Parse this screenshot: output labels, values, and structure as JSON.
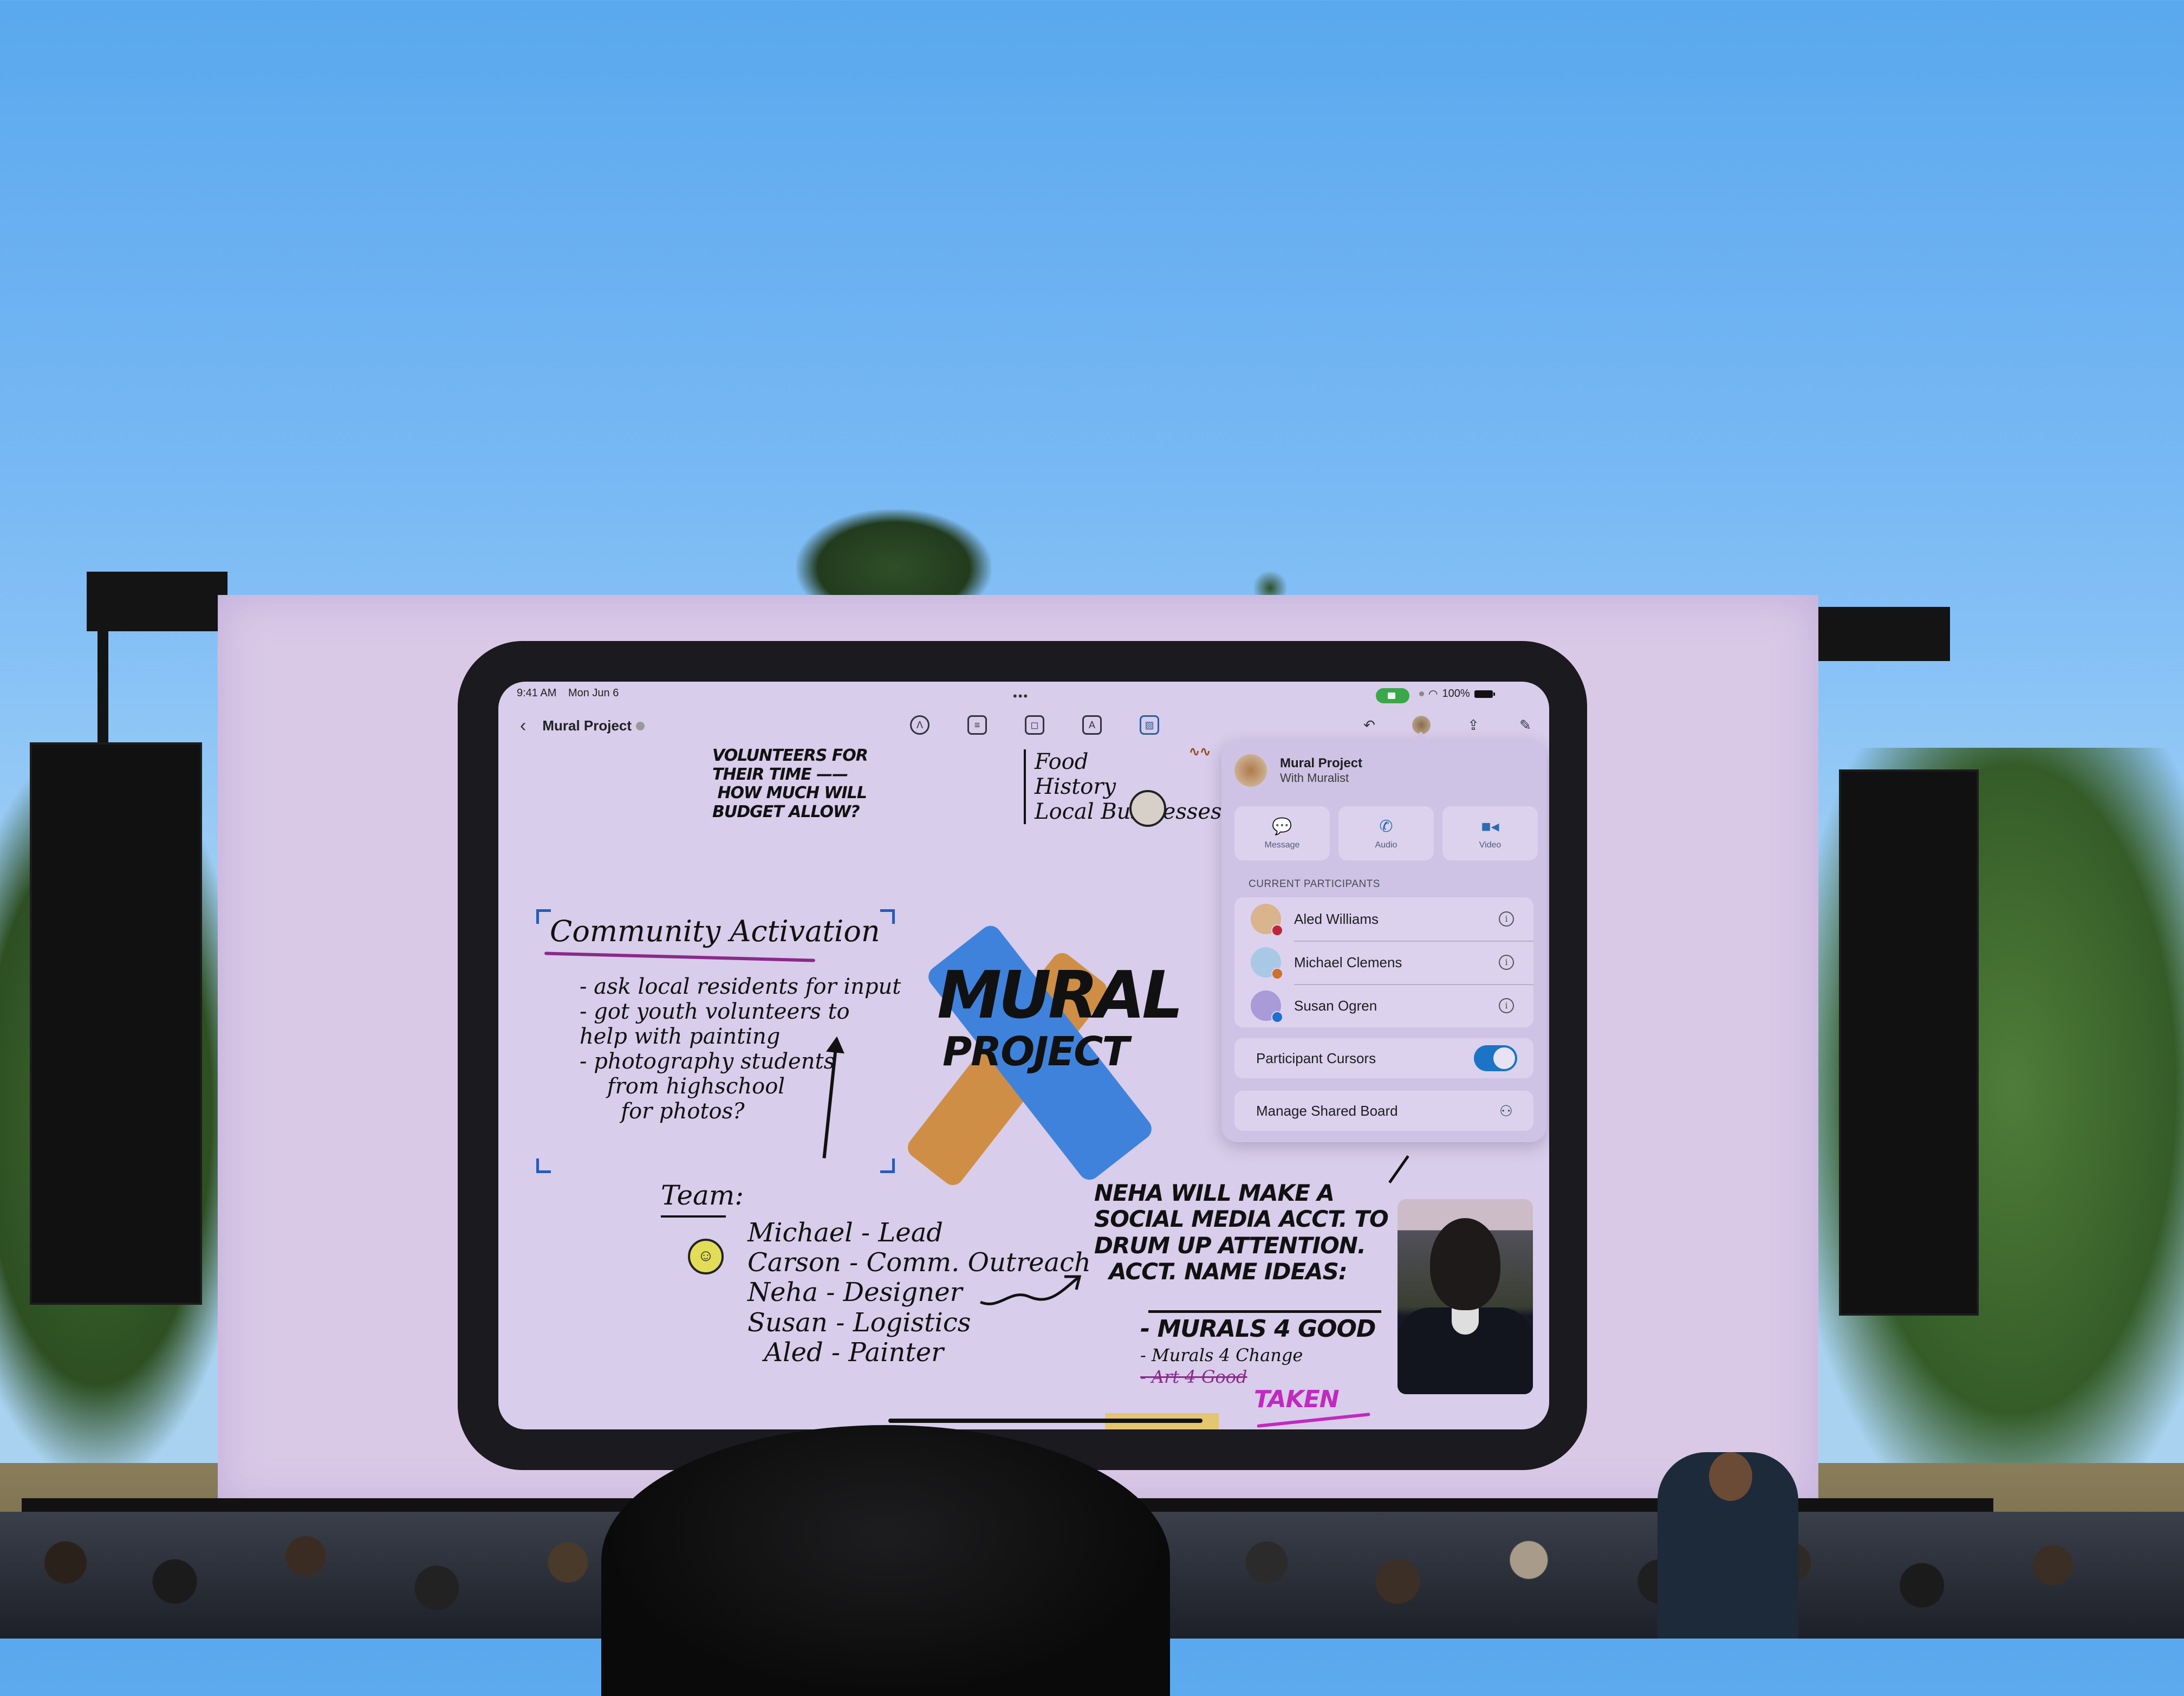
{
  "status_bar": {
    "time": "9:41 AM",
    "date": "Mon Jun 6",
    "multitask_dots": "•••",
    "battery": "100%",
    "icons": [
      "facetime-active-icon",
      "wifi-icon",
      "battery-icon"
    ]
  },
  "toolbar": {
    "back_icon": "‹",
    "title": "Mural Project",
    "tools": [
      {
        "name": "pen-tool",
        "glyph": "Λ"
      },
      {
        "name": "sticky-note",
        "glyph": "≡"
      },
      {
        "name": "shapes",
        "glyph": "◻"
      },
      {
        "name": "text-box",
        "glyph": "A"
      },
      {
        "name": "media",
        "glyph": "▨"
      }
    ],
    "right_icons": [
      {
        "name": "undo",
        "glyph": "↶"
      },
      {
        "name": "collaboration",
        "glyph": ""
      },
      {
        "name": "share",
        "glyph": "⇪"
      },
      {
        "name": "new-board",
        "glyph": "✎"
      }
    ]
  },
  "canvas": {
    "top_note": "VOLUNTEERS FOR\nTHEIR TIME ——\n HOW MUCH WILL\nBUDGET ALLOW?",
    "topics": "Food\nHistory\nLocal Businesses",
    "community_title": "Community Activation",
    "community_items": "- ask local residents for input\n- got youth volunteers to\nhelp with painting\n- photography students\n    from highschool\n      for photos?",
    "logo_line1": "MURAL",
    "logo_line2": "PROJECT",
    "team_label": "Team:",
    "team_list": "Michael - Lead\nCarson - Comm. Outreach\nNeha - Designer\nSusan - Logistics\n  Aled - Painter",
    "smiley": "☺",
    "neha_note": "NEHA WILL MAKE A\nSOCIAL MEDIA ACCT. TO\nDRUM UP ATTENTION.\n  ACCT. NAME IDEAS:",
    "idea_1": "- MURALS 4 GOOD",
    "idea_2": "- Murals 4 Change",
    "idea_3": "- Art 4 Good",
    "taken": "TAKEN"
  },
  "popover": {
    "board_title": "Mural Project",
    "board_subtitle": "With Muralist",
    "actions": [
      {
        "label": "Message",
        "icon": "💬"
      },
      {
        "label": "Audio",
        "icon": "✆"
      },
      {
        "label": "Video",
        "icon": "■◂"
      }
    ],
    "section_label": "CURRENT PARTICIPANTS",
    "participants": [
      {
        "name": "Aled Williams",
        "avatar_color": "#d9b48c",
        "dot_color": "#c0263a"
      },
      {
        "name": "Michael Clemens",
        "avatar_color": "#a9c8e6",
        "dot_color": "#d0702a"
      },
      {
        "name": "Susan Ogren",
        "avatar_color": "#a99ad8",
        "dot_color": "#1f6fd0"
      }
    ],
    "participant_cursors_label": "Participant Cursors",
    "participant_cursors_on": true,
    "manage_label": "Manage Shared Board",
    "info_glyph": "i",
    "manage_glyph": "⚇"
  },
  "colors": {
    "accent_blue": "#1b74c6",
    "facetime_green": "#3aa74a",
    "highlight_magenta": "#c02ac0"
  }
}
